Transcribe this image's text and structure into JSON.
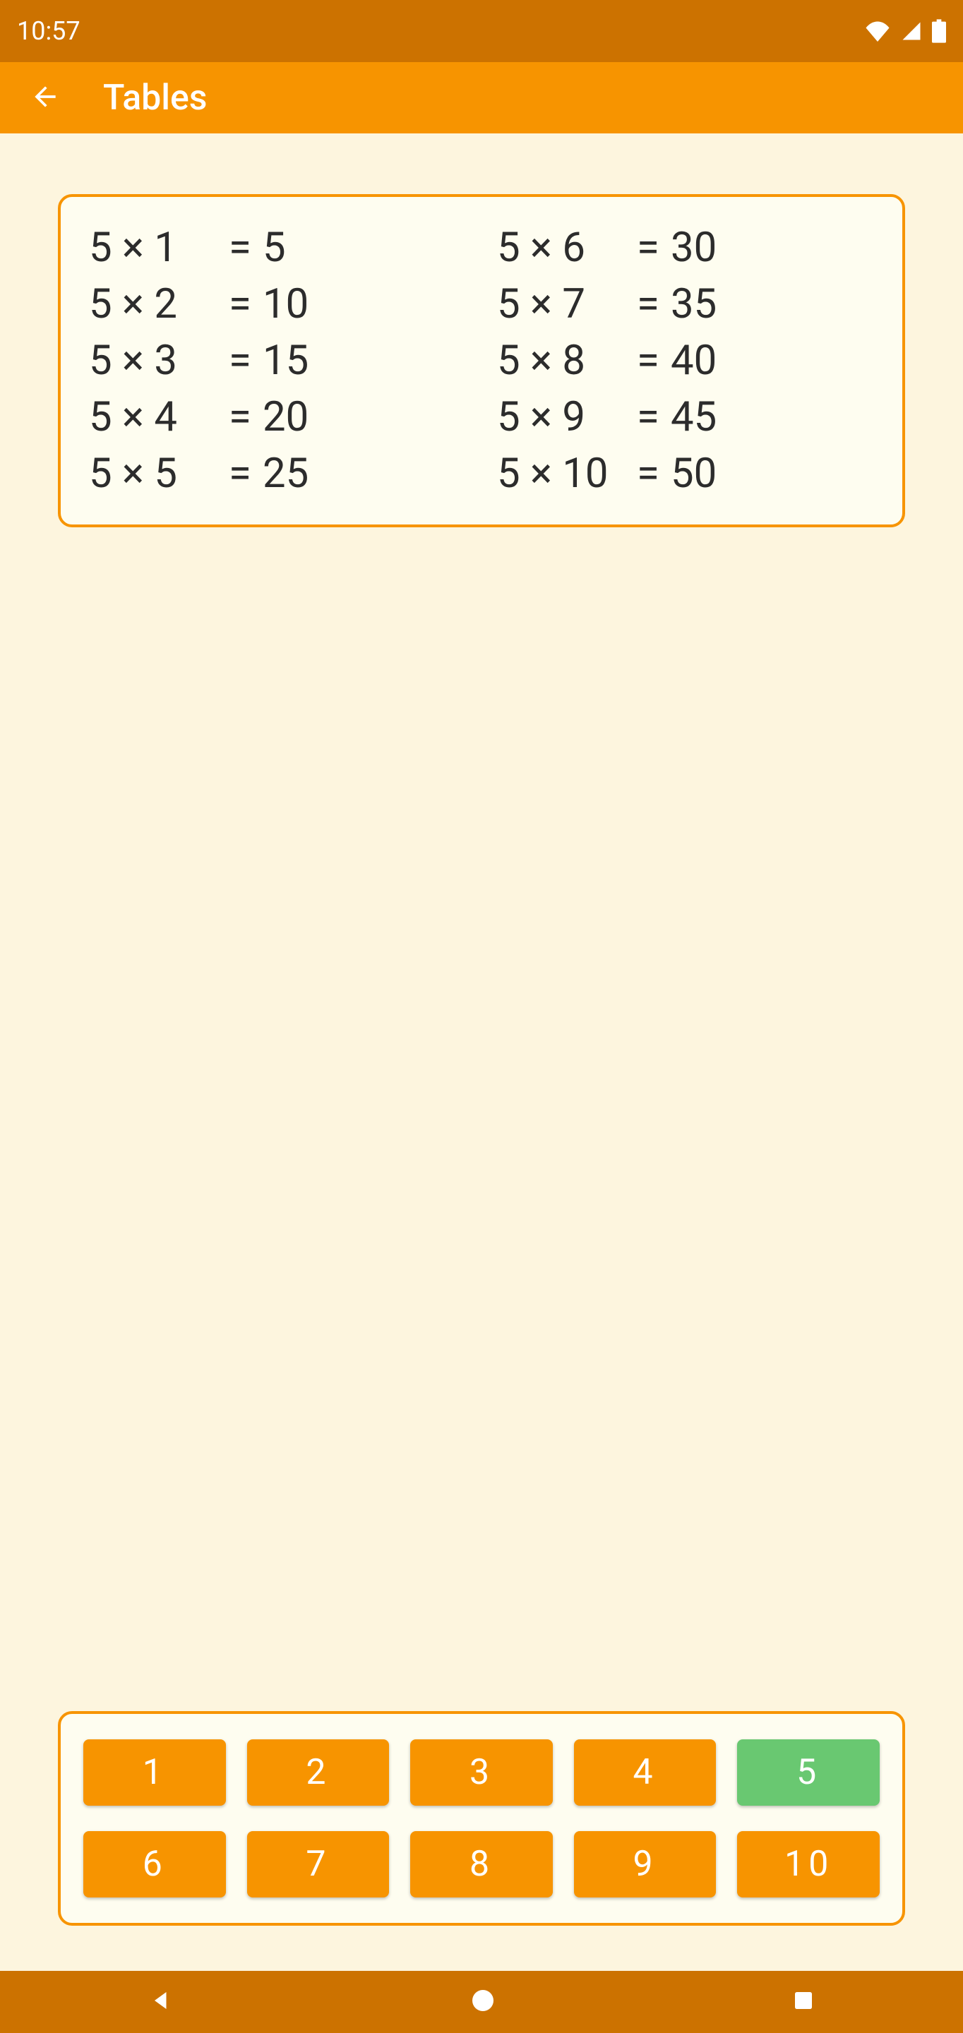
{
  "statusBar": {
    "time": "10:57"
  },
  "appBar": {
    "title": "Tables"
  },
  "table": {
    "left": [
      {
        "expr": "5 × 1",
        "eq": "=",
        "res": "5"
      },
      {
        "expr": "5 × 2",
        "eq": "=",
        "res": "10"
      },
      {
        "expr": "5 × 3",
        "eq": "=",
        "res": "15"
      },
      {
        "expr": "5 × 4",
        "eq": "=",
        "res": "20"
      },
      {
        "expr": "5 × 5",
        "eq": "=",
        "res": "25"
      }
    ],
    "right": [
      {
        "expr": "5 × 6",
        "eq": "=",
        "res": "30"
      },
      {
        "expr": "5 × 7",
        "eq": "=",
        "res": "35"
      },
      {
        "expr": "5 × 8",
        "eq": "=",
        "res": "40"
      },
      {
        "expr": "5 × 9",
        "eq": "=",
        "res": "45"
      },
      {
        "expr": "5 × 10",
        "eq": "=",
        "res": "50"
      }
    ]
  },
  "selector": {
    "buttons": [
      "1",
      "2",
      "3",
      "4",
      "5",
      "6",
      "7",
      "8",
      "9",
      "10"
    ],
    "selectedIndex": 4
  }
}
